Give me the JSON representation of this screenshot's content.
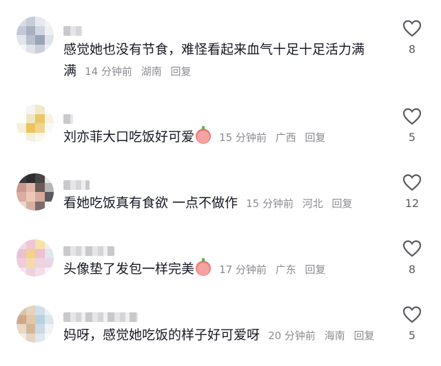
{
  "comments": [
    {
      "text_line1": "感觉她也没有节食，难怪看起来血气十足十足活力满",
      "text_line2": "满",
      "time": "14 分钟前",
      "location": "湖南",
      "reply": "回复",
      "likes": "8",
      "emoji": false
    },
    {
      "text_line1": "刘亦菲大口吃饭好可爱",
      "time": "15 分钟前",
      "location": "广西",
      "reply": "回复",
      "likes": "5",
      "emoji": true
    },
    {
      "text_line1": "看她吃饭真有食欲  一点不做作",
      "time": "15 分钟前",
      "location": "河北",
      "reply": "回复",
      "likes": "12",
      "emoji": false
    },
    {
      "text_line1": "头像垫了发包一样完美",
      "time": "17 分钟前",
      "location": "广东",
      "reply": "回复",
      "likes": "8",
      "emoji": true
    },
    {
      "text_line1": "妈呀，感觉她吃饭的样子好可爱呀",
      "time": "20 分钟前",
      "location": "海南",
      "reply": "回复",
      "likes": "5",
      "emoji": false
    }
  ]
}
